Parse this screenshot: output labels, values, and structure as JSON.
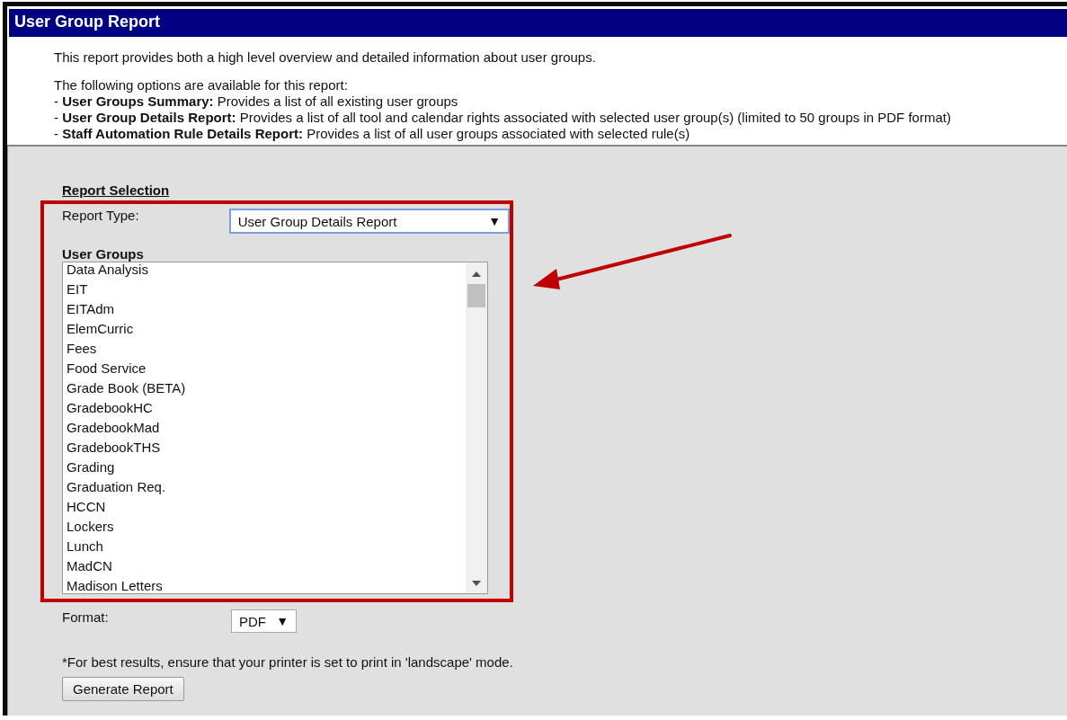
{
  "window": {
    "title": "User Group Report"
  },
  "intro": {
    "description": "This report provides both a high level overview and detailed information about user groups.",
    "options_heading": "The following options are available for this report:",
    "options": [
      "- **User Groups Summary:** Provides a list of all existing user groups",
      "- **User Group Details Report:** Provides a list of all tool and calendar rights associated with selected user group(s) (limited to 50 groups in PDF format)",
      "- **Staff Automation Rule Details Report:** Provides a list of all user groups associated with selected rule(s)"
    ]
  },
  "form": {
    "section_title": "Report Selection",
    "report_type": {
      "label": "Report Type:",
      "value": "User Group Details Report",
      "caret": "▼"
    },
    "user_groups": {
      "label": "User Groups",
      "items": [
        {
          "label": "Data Analysis",
          "selected": false
        },
        {
          "label": "EIT",
          "selected": false
        },
        {
          "label": "EITAdm",
          "selected": false
        },
        {
          "label": "ElemCurric",
          "selected": false
        },
        {
          "label": "Fees",
          "selected": false
        },
        {
          "label": "Food Service",
          "selected": false
        },
        {
          "label": "Grade Book (BETA)",
          "selected": false
        },
        {
          "label": "GradebookHC",
          "selected": false
        },
        {
          "label": "GradebookMad",
          "selected": false
        },
        {
          "label": "GradebookTHS",
          "selected": false
        },
        {
          "label": "Grading",
          "selected": false
        },
        {
          "label": "Graduation Req.",
          "selected": false
        },
        {
          "label": "HCCN",
          "selected": false
        },
        {
          "label": "Lockers",
          "selected": false
        },
        {
          "label": "Lunch",
          "selected": false
        },
        {
          "label": "MadCN",
          "selected": false
        },
        {
          "label": "Madison Letters",
          "selected": false
        }
      ]
    },
    "format": {
      "label": "Format:",
      "value": "PDF",
      "caret": "▼"
    },
    "note": "*For best results, ensure that your printer is set to print in 'landscape' mode.",
    "button": "Generate Report"
  }
}
